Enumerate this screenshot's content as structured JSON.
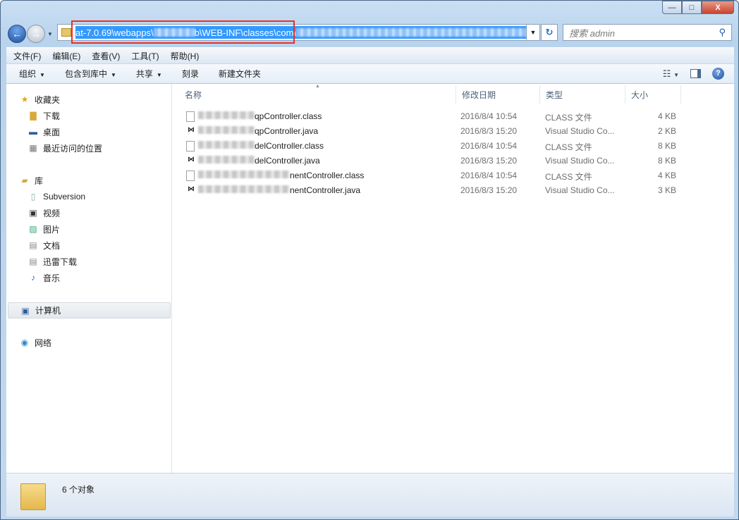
{
  "window": {
    "controls": {
      "minimize": "—",
      "maximize": "□",
      "close": "X"
    }
  },
  "address": {
    "path_prefix": "at-7.0.69\\webapps\\",
    "path_mid": "b\\WEB-INF\\classes\\com\\",
    "dropdown": "▼",
    "refresh": "↻"
  },
  "search": {
    "placeholder": "搜索 admin",
    "icon": "search-icon"
  },
  "menu": [
    "文件(F)",
    "编辑(E)",
    "查看(V)",
    "工具(T)",
    "帮助(H)"
  ],
  "toolbar": {
    "organize": "组织",
    "include_library": "包含到库中",
    "share": "共享",
    "burn": "刻录",
    "new_folder": "新建文件夹"
  },
  "sidebar": {
    "favorites": {
      "label": "收藏夹",
      "items": [
        "下载",
        "桌面",
        "最近访问的位置"
      ]
    },
    "libraries": {
      "label": "库",
      "items": [
        "Subversion",
        "视频",
        "图片",
        "文档",
        "迅雷下载",
        "音乐"
      ]
    },
    "computer": "计算机",
    "network": "网络"
  },
  "columns": {
    "name": "名称",
    "date": "修改日期",
    "type": "类型",
    "size": "大小"
  },
  "files": [
    {
      "name_visible": "qpController.class",
      "date": "2016/8/4 10:54",
      "type": "CLASS 文件",
      "size": "4 KB",
      "icon": "file-icon"
    },
    {
      "name_visible": "qpController.java",
      "date": "2016/8/3 15:20",
      "type": "Visual Studio Co...",
      "size": "2 KB",
      "icon": "visual-studio-icon"
    },
    {
      "name_visible": "delController.class",
      "date": "2016/8/4 10:54",
      "type": "CLASS 文件",
      "size": "8 KB",
      "icon": "file-icon"
    },
    {
      "name_visible": "delController.java",
      "date": "2016/8/3 15:20",
      "type": "Visual Studio Co...",
      "size": "8 KB",
      "icon": "visual-studio-icon"
    },
    {
      "name_visible": "nentController.class",
      "date": "2016/8/4 10:54",
      "type": "CLASS 文件",
      "size": "4 KB",
      "icon": "file-icon"
    },
    {
      "name_visible": "nentController.java",
      "date": "2016/8/3 15:20",
      "type": "Visual Studio Co...",
      "size": "3 KB",
      "icon": "visual-studio-icon"
    }
  ],
  "status": {
    "count": "6 个对象"
  },
  "colors": {
    "selection": "#3399ff",
    "highlight_box": "#e8302a"
  }
}
